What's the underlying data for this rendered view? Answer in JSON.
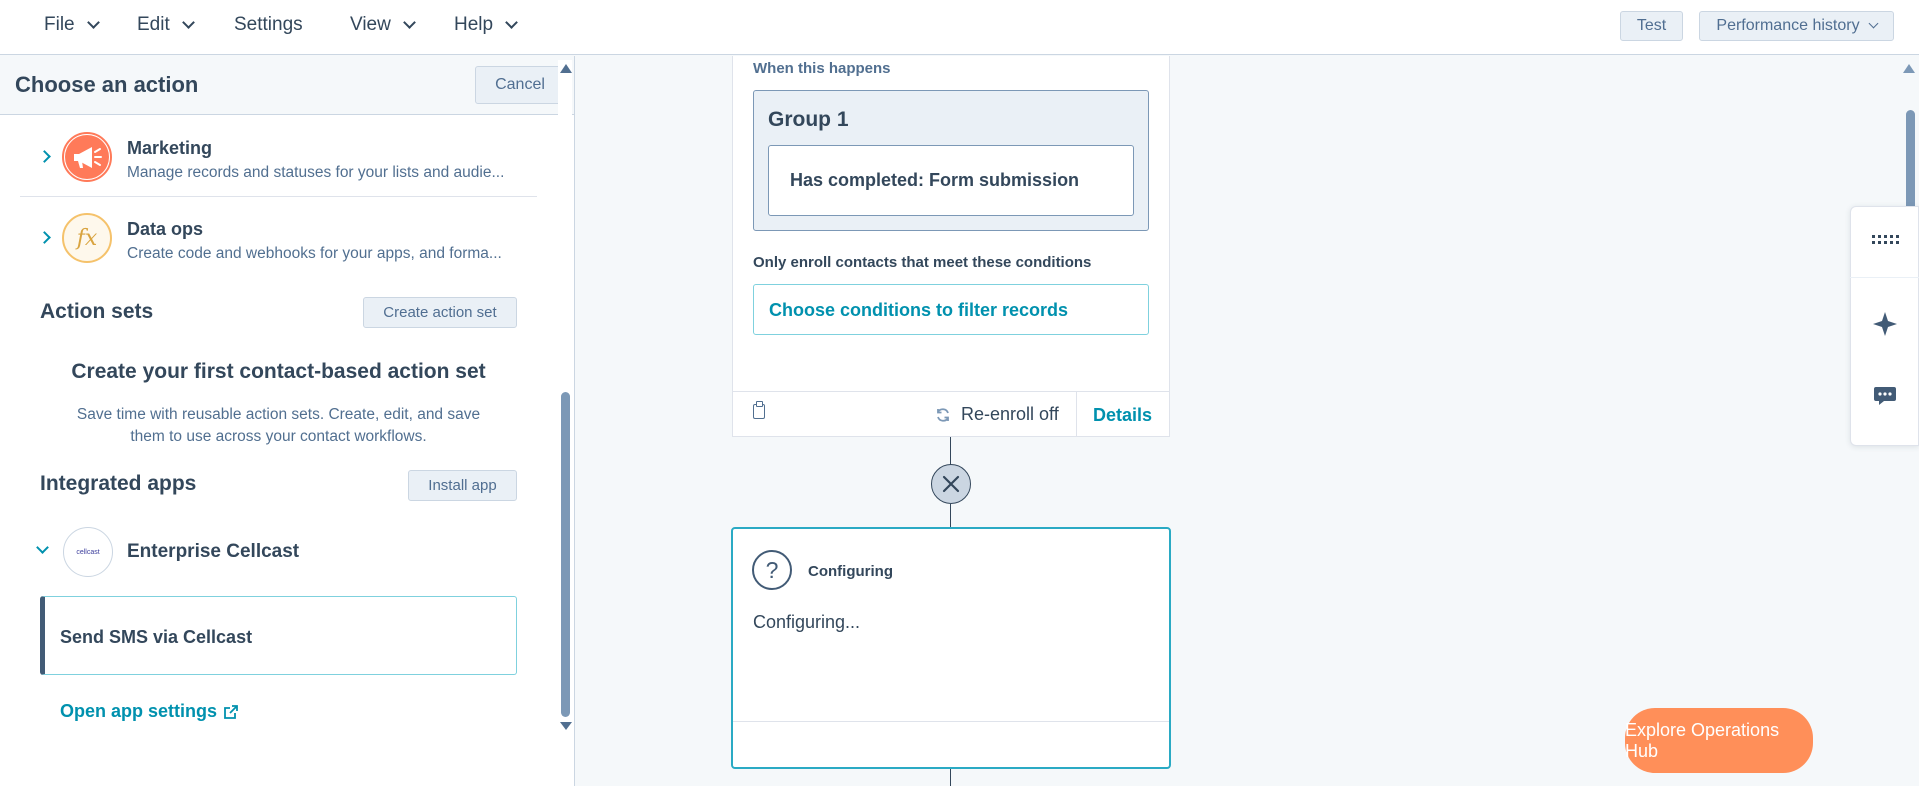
{
  "menu": {
    "file": "File",
    "edit": "Edit",
    "settings": "Settings",
    "view": "View",
    "help": "Help"
  },
  "header_actions": {
    "test": "Test",
    "performance_history": "Performance history"
  },
  "panel": {
    "title": "Choose an action",
    "cancel": "Cancel",
    "categories": [
      {
        "title": "Marketing",
        "description": "Manage records and statuses for your lists and audie...",
        "icon": "megaphone-icon",
        "color": "#ff7a59"
      },
      {
        "title": "Data ops",
        "description": "Create code and webhooks for your apps, and forma...",
        "icon": "function-icon",
        "color": "#f5c26b"
      }
    ],
    "action_sets": {
      "title": "Action sets",
      "create_button": "Create action set",
      "empty_title": "Create your first contact-based action set",
      "empty_desc": "Save time with reusable action sets. Create, edit, and save them to use across your contact workflows."
    },
    "integrated_apps": {
      "title": "Integrated apps",
      "install_button": "Install app",
      "app_name": "Enterprise Cellcast",
      "app_logo_text": "cellcast",
      "action_label": "Send SMS via Cellcast",
      "settings_link": "Open app settings"
    }
  },
  "workflow": {
    "trigger": {
      "when_label": "When this happens",
      "group_title": "Group 1",
      "condition": "Has completed: Form submission",
      "enroll_label": "Only enroll contacts that meet these conditions",
      "filter_button": "Choose conditions to filter records",
      "reenroll": "Re-enroll off",
      "details": "Details"
    },
    "configuring": {
      "title": "Configuring",
      "body": "Configuring..."
    }
  },
  "cta": {
    "label": "Explore Operations Hub"
  },
  "colors": {
    "accent": "#0091ae",
    "text": "#33475b",
    "cta": "#ff8f59",
    "border": "#cbd6e2"
  }
}
